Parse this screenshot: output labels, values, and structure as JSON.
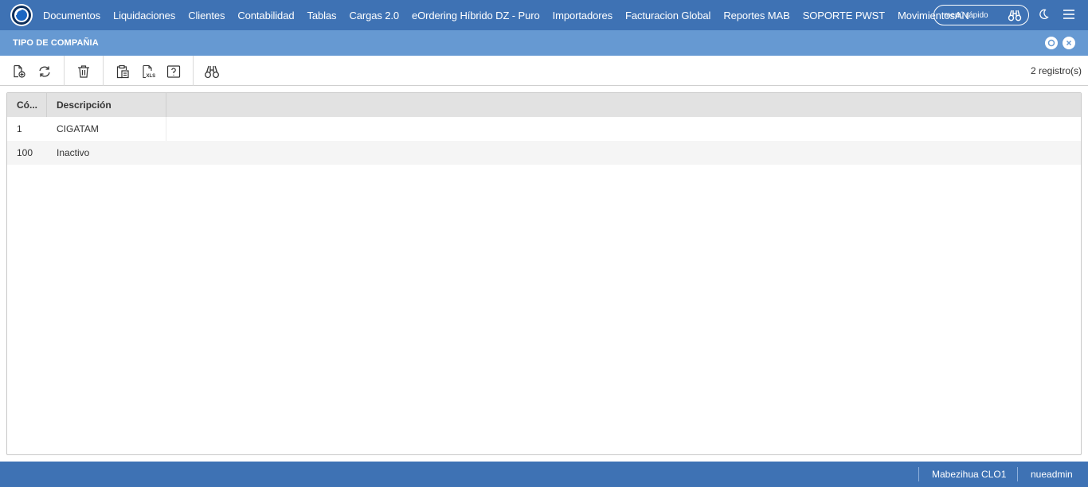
{
  "nav": {
    "items": [
      "Documentos",
      "Liquidaciones",
      "Clientes",
      "Contabilidad",
      "Tablas",
      "Cargas 2.0",
      "eOrdering Híbrido DZ - Puro",
      "Importadores",
      "Facturacion Global",
      "Reportes MAB",
      "SOPORTE PWST",
      "MovimientosAN"
    ],
    "quick_menu_placeholder": "menú rápido"
  },
  "window": {
    "title": "TIPO DE COMPAÑIA"
  },
  "toolbar": {
    "records_label": "2 registro(s)",
    "icons": [
      "new-document-icon",
      "refresh-icon",
      "delete-icon",
      "clipboard-export-icon",
      "xls-export-icon",
      "help-icon",
      "binoculars-icon"
    ]
  },
  "grid": {
    "columns": [
      "Có...",
      "Descripción"
    ],
    "rows": [
      [
        "1",
        "CIGATAM"
      ],
      [
        "100",
        "Inactivo"
      ]
    ]
  },
  "status": {
    "company": "Mabezihua CLO1",
    "user": "nueadmin"
  },
  "colors": {
    "nav_bg": "#3e72b4",
    "window_bar_bg": "#6699d2",
    "grid_header_bg": "#e2e2e2"
  }
}
